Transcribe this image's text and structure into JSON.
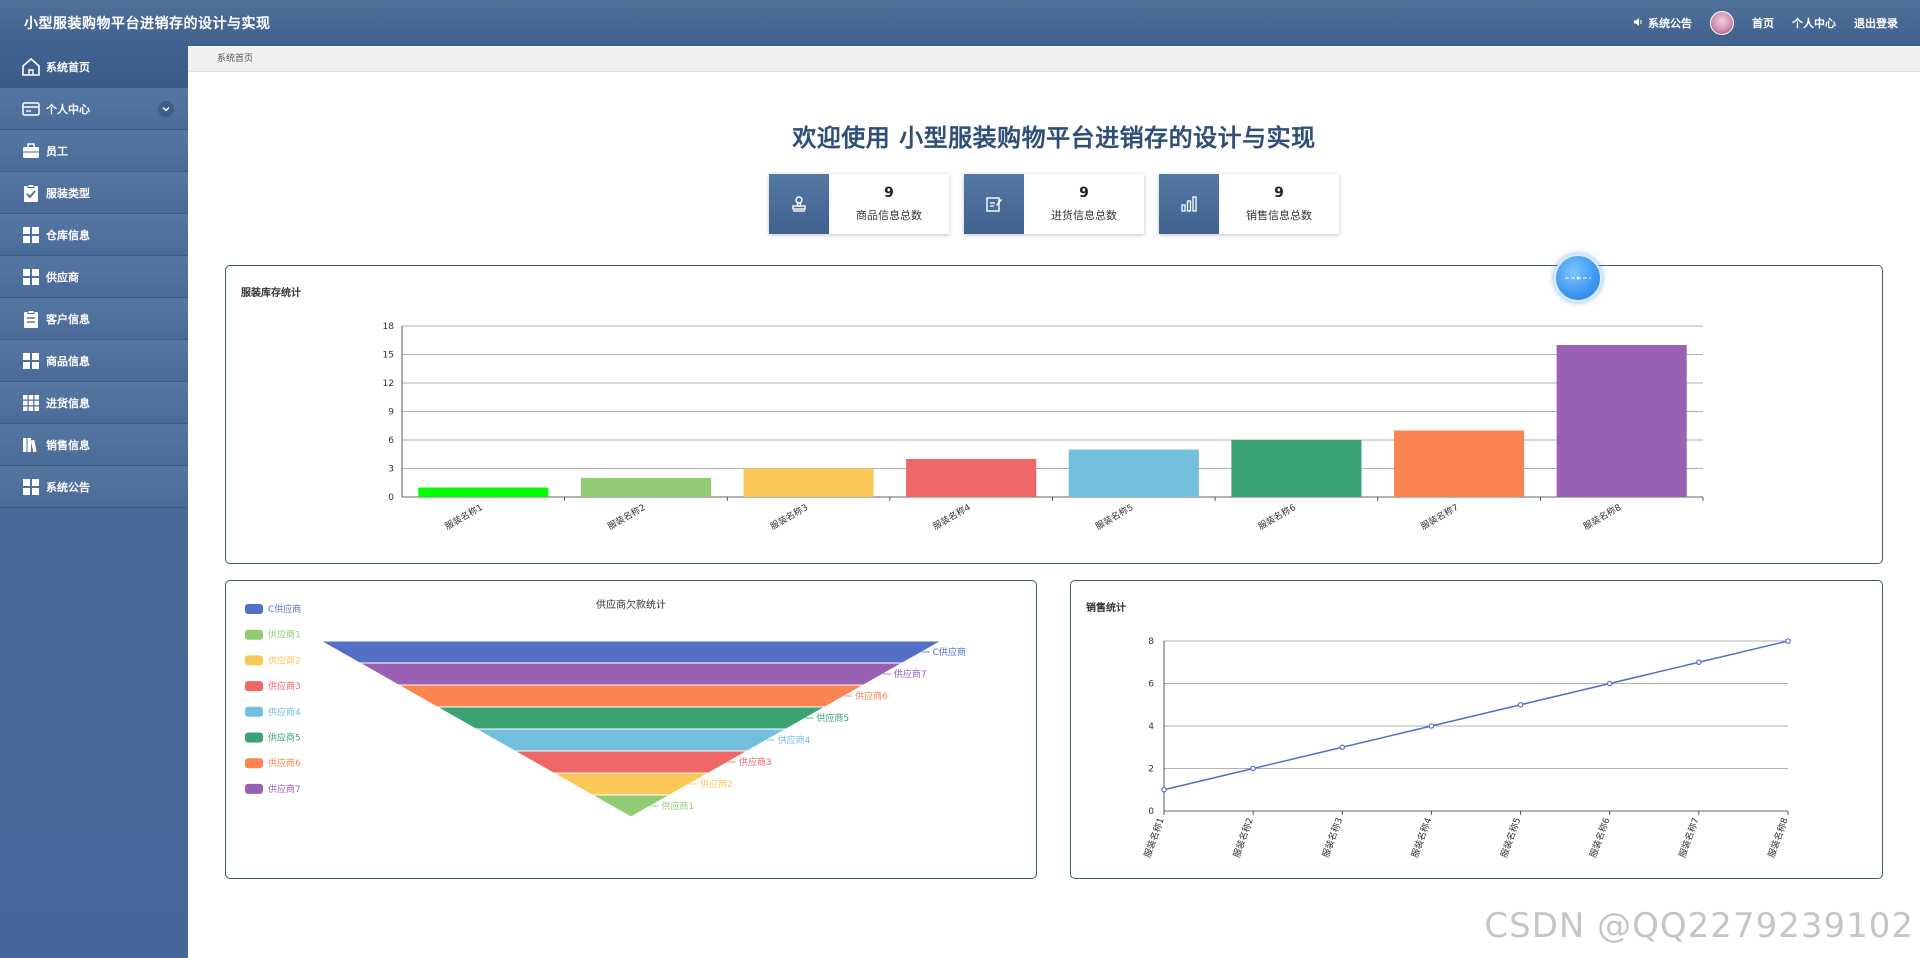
{
  "header": {
    "app_title": "小型服装购物平台进销存的设计与实现",
    "notice": "系统公告",
    "home": "首页",
    "profile": "个人中心",
    "logout": "退出登录"
  },
  "sidebar": {
    "items": [
      {
        "label": "系统首页",
        "icon": "home-icon"
      },
      {
        "label": "个人中心",
        "icon": "card-icon",
        "expandable": true
      },
      {
        "label": "员工",
        "icon": "briefcase-icon"
      },
      {
        "label": "服装类型",
        "icon": "clipboard-check-icon"
      },
      {
        "label": "仓库信息",
        "icon": "grid-icon"
      },
      {
        "label": "供应商",
        "icon": "grid-icon"
      },
      {
        "label": "客户信息",
        "icon": "clipboard-icon"
      },
      {
        "label": "商品信息",
        "icon": "grid-icon"
      },
      {
        "label": "进货信息",
        "icon": "grid9-icon"
      },
      {
        "label": "销售信息",
        "icon": "books-icon"
      },
      {
        "label": "系统公告",
        "icon": "grid-icon"
      }
    ]
  },
  "breadcrumb": "系统首页",
  "welcome": "欢迎使用 小型服装购物平台进销存的设计与实现",
  "stats": [
    {
      "value": "9",
      "label": "商品信息总数",
      "icon": "stamp-icon"
    },
    {
      "value": "9",
      "label": "进货信息总数",
      "icon": "edit-icon"
    },
    {
      "value": "9",
      "label": "销售信息总数",
      "icon": "bar-chart-icon"
    }
  ],
  "watermark": "CSDN @QQ2279239102",
  "chart_data": [
    {
      "type": "bar",
      "title": "服装库存统计",
      "categories": [
        "服装名称1",
        "服装名称2",
        "服装名称3",
        "服装名称4",
        "服装名称5",
        "服装名称6",
        "服装名称7",
        "服装名称8"
      ],
      "values": [
        1,
        2,
        3,
        4,
        5,
        6,
        7,
        16
      ],
      "ylim": [
        0,
        18
      ],
      "yticks": [
        0,
        3,
        6,
        9,
        12,
        15,
        18
      ],
      "colors": [
        "#00ff00",
        "#91cc75",
        "#fac858",
        "#ee6666",
        "#73c0de",
        "#3ba272",
        "#fc8452",
        "#9a60b4"
      ],
      "grid": true
    },
    {
      "type": "funnel",
      "title": "供应商欠款统计",
      "categories": [
        "C供应商",
        "供应商7",
        "供应商6",
        "供应商5",
        "供应商4",
        "供应商3",
        "供应商2",
        "供应商1"
      ],
      "legend": [
        "C供应商",
        "供应商1",
        "供应商2",
        "供应商3",
        "供应商4",
        "供应商5",
        "供应商6",
        "供应商7"
      ],
      "colors": {
        "C供应商": "#5470c6",
        "供应商1": "#91cc75",
        "供应商2": "#fac858",
        "供应商3": "#ee6666",
        "供应商4": "#73c0de",
        "供应商5": "#3ba272",
        "供应商6": "#fc8452",
        "供应商7": "#9a60b4"
      },
      "legend_position": "left"
    },
    {
      "type": "line",
      "title": "销售统计",
      "categories": [
        "服装名称1",
        "服装名称2",
        "服装名称3",
        "服装名称4",
        "服装名称5",
        "服装名称6",
        "服装名称7",
        "服装名称8"
      ],
      "values": [
        1,
        2,
        3,
        4,
        5,
        6,
        7,
        8
      ],
      "ylim": [
        0,
        8
      ],
      "yticks": [
        0,
        2,
        4,
        6,
        8
      ],
      "color": "#5470c6",
      "grid": true
    }
  ]
}
